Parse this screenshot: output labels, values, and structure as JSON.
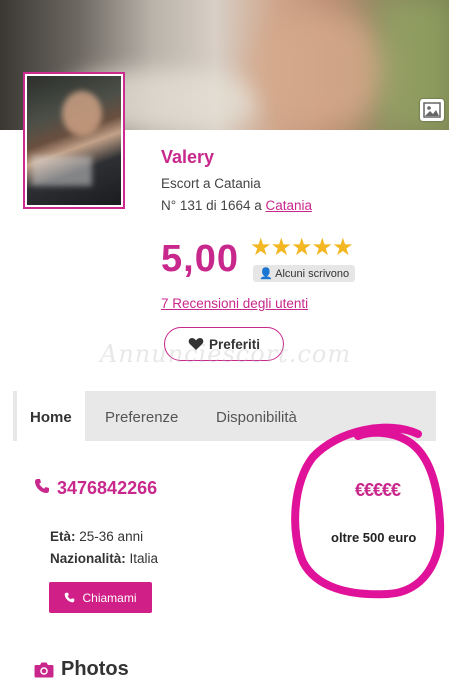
{
  "profile": {
    "name": "Valery",
    "subtitle": "Escort a Catania",
    "rank_text": "N° 131  di 1664 a",
    "city_link": "Catania",
    "rating": "5,00",
    "stars": "★★★★★",
    "some_write_label": "Alcuni scrivono",
    "reviews_link": "7 Recensioni degli utenti",
    "favorite_label": "Preferiti",
    "watermark": "Annunciescort.com"
  },
  "tabs": [
    {
      "label": "Home",
      "active": true
    },
    {
      "label": "Preferenze",
      "active": false
    },
    {
      "label": "Disponibilità",
      "active": false
    }
  ],
  "details": {
    "phone": "3476842266",
    "price_symbols": "€€€€€",
    "price_text": "oltre 500 euro",
    "age_label": "Età:",
    "age_value": "25-36 anni",
    "nationality_label": "Nazionalità:",
    "nationality_value": "Italia",
    "call_label": "Chiamami"
  },
  "sections": {
    "photos_title": "Photos"
  },
  "colors": {
    "accent": "#c8288c",
    "star": "#f2b722",
    "annotation": "#e0129a"
  }
}
